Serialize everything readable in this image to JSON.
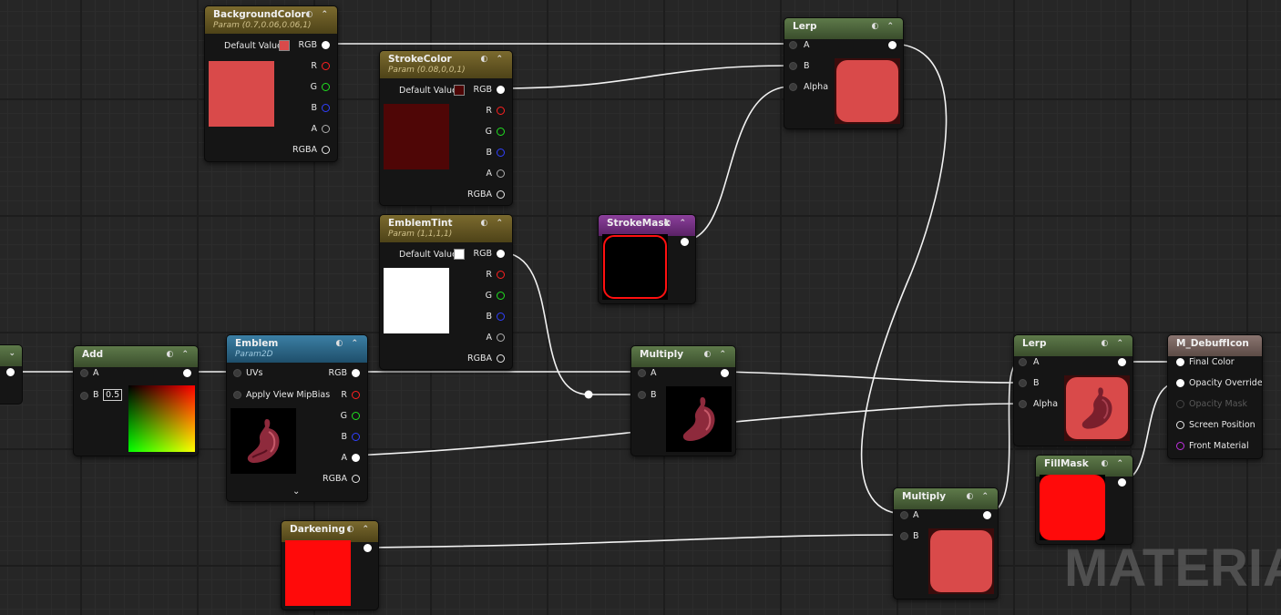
{
  "watermark": "MATERIAL",
  "nodes": {
    "background_color": {
      "title": "BackgroundColor",
      "subtitle": "Param (0.7,0.06,0.06,1)",
      "default_value_label": "Default Value",
      "color": "#d94a4a",
      "outputs": [
        "RGB",
        "R",
        "G",
        "B",
        "A",
        "RGBA"
      ]
    },
    "stroke_color": {
      "title": "StrokeColor",
      "subtitle": "Param (0.08,0,0,1)",
      "default_value_label": "Default Value",
      "color": "#4f0606",
      "outputs": [
        "RGB",
        "R",
        "G",
        "B",
        "A",
        "RGBA"
      ]
    },
    "emblem_tint": {
      "title": "EmblemTint",
      "subtitle": "Param (1,1,1,1)",
      "default_value_label": "Default Value",
      "color": "#ffffff",
      "outputs": [
        "RGB",
        "R",
        "G",
        "B",
        "A",
        "RGBA"
      ]
    },
    "lerp_top": {
      "title": "Lerp",
      "inputs": [
        "A",
        "B",
        "Alpha"
      ]
    },
    "stroke_mask": {
      "title": "StrokeMask"
    },
    "add": {
      "title": "Add",
      "inputs": [
        "A",
        "B"
      ],
      "b_value": "0.5"
    },
    "emblem": {
      "title": "Emblem",
      "subtitle": "Param2D",
      "inputs": [
        "UVs",
        "Apply View MipBias"
      ],
      "outputs": [
        "RGB",
        "R",
        "G",
        "B",
        "A",
        "RGBA"
      ]
    },
    "multiply_mid": {
      "title": "Multiply",
      "inputs": [
        "A",
        "B"
      ]
    },
    "darkening": {
      "title": "Darkening"
    },
    "lerp_right": {
      "title": "Lerp",
      "inputs": [
        "A",
        "B",
        "Alpha"
      ]
    },
    "fill_mask": {
      "title": "FillMask"
    },
    "multiply_bottom": {
      "title": "Multiply",
      "inputs": [
        "A",
        "B"
      ]
    },
    "result": {
      "title": "M_DebuffIcon",
      "pins": [
        "Final Color",
        "Opacity Override",
        "Opacity Mask",
        "Screen Position",
        "Front Material"
      ]
    }
  },
  "colors": {
    "param_header": "#7b6a2e",
    "math_header": "#5e7a4a",
    "texture_header": "#3b7fa4",
    "mask_header": "#8b3f9b",
    "result_header": "#8a7570",
    "wire": "#f2f2f2"
  },
  "icons": [
    "collapse-arrow-icon",
    "preview-toggle-icon",
    "expand-chevron-icon",
    "stomach-emblem-icon"
  ]
}
